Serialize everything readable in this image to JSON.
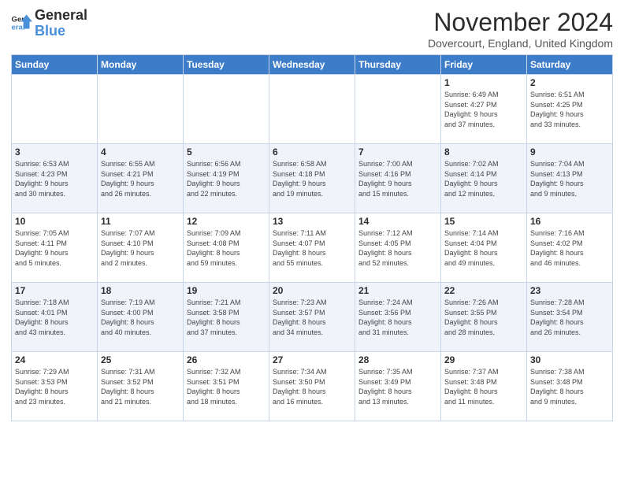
{
  "logo": {
    "line1": "General",
    "line2": "Blue"
  },
  "title": "November 2024",
  "subtitle": "Dovercourt, England, United Kingdom",
  "headers": [
    "Sunday",
    "Monday",
    "Tuesday",
    "Wednesday",
    "Thursday",
    "Friday",
    "Saturday"
  ],
  "weeks": [
    [
      {
        "day": "",
        "info": ""
      },
      {
        "day": "",
        "info": ""
      },
      {
        "day": "",
        "info": ""
      },
      {
        "day": "",
        "info": ""
      },
      {
        "day": "",
        "info": ""
      },
      {
        "day": "1",
        "info": "Sunrise: 6:49 AM\nSunset: 4:27 PM\nDaylight: 9 hours\nand 37 minutes."
      },
      {
        "day": "2",
        "info": "Sunrise: 6:51 AM\nSunset: 4:25 PM\nDaylight: 9 hours\nand 33 minutes."
      }
    ],
    [
      {
        "day": "3",
        "info": "Sunrise: 6:53 AM\nSunset: 4:23 PM\nDaylight: 9 hours\nand 30 minutes."
      },
      {
        "day": "4",
        "info": "Sunrise: 6:55 AM\nSunset: 4:21 PM\nDaylight: 9 hours\nand 26 minutes."
      },
      {
        "day": "5",
        "info": "Sunrise: 6:56 AM\nSunset: 4:19 PM\nDaylight: 9 hours\nand 22 minutes."
      },
      {
        "day": "6",
        "info": "Sunrise: 6:58 AM\nSunset: 4:18 PM\nDaylight: 9 hours\nand 19 minutes."
      },
      {
        "day": "7",
        "info": "Sunrise: 7:00 AM\nSunset: 4:16 PM\nDaylight: 9 hours\nand 15 minutes."
      },
      {
        "day": "8",
        "info": "Sunrise: 7:02 AM\nSunset: 4:14 PM\nDaylight: 9 hours\nand 12 minutes."
      },
      {
        "day": "9",
        "info": "Sunrise: 7:04 AM\nSunset: 4:13 PM\nDaylight: 9 hours\nand 9 minutes."
      }
    ],
    [
      {
        "day": "10",
        "info": "Sunrise: 7:05 AM\nSunset: 4:11 PM\nDaylight: 9 hours\nand 5 minutes."
      },
      {
        "day": "11",
        "info": "Sunrise: 7:07 AM\nSunset: 4:10 PM\nDaylight: 9 hours\nand 2 minutes."
      },
      {
        "day": "12",
        "info": "Sunrise: 7:09 AM\nSunset: 4:08 PM\nDaylight: 8 hours\nand 59 minutes."
      },
      {
        "day": "13",
        "info": "Sunrise: 7:11 AM\nSunset: 4:07 PM\nDaylight: 8 hours\nand 55 minutes."
      },
      {
        "day": "14",
        "info": "Sunrise: 7:12 AM\nSunset: 4:05 PM\nDaylight: 8 hours\nand 52 minutes."
      },
      {
        "day": "15",
        "info": "Sunrise: 7:14 AM\nSunset: 4:04 PM\nDaylight: 8 hours\nand 49 minutes."
      },
      {
        "day": "16",
        "info": "Sunrise: 7:16 AM\nSunset: 4:02 PM\nDaylight: 8 hours\nand 46 minutes."
      }
    ],
    [
      {
        "day": "17",
        "info": "Sunrise: 7:18 AM\nSunset: 4:01 PM\nDaylight: 8 hours\nand 43 minutes."
      },
      {
        "day": "18",
        "info": "Sunrise: 7:19 AM\nSunset: 4:00 PM\nDaylight: 8 hours\nand 40 minutes."
      },
      {
        "day": "19",
        "info": "Sunrise: 7:21 AM\nSunset: 3:58 PM\nDaylight: 8 hours\nand 37 minutes."
      },
      {
        "day": "20",
        "info": "Sunrise: 7:23 AM\nSunset: 3:57 PM\nDaylight: 8 hours\nand 34 minutes."
      },
      {
        "day": "21",
        "info": "Sunrise: 7:24 AM\nSunset: 3:56 PM\nDaylight: 8 hours\nand 31 minutes."
      },
      {
        "day": "22",
        "info": "Sunrise: 7:26 AM\nSunset: 3:55 PM\nDaylight: 8 hours\nand 28 minutes."
      },
      {
        "day": "23",
        "info": "Sunrise: 7:28 AM\nSunset: 3:54 PM\nDaylight: 8 hours\nand 26 minutes."
      }
    ],
    [
      {
        "day": "24",
        "info": "Sunrise: 7:29 AM\nSunset: 3:53 PM\nDaylight: 8 hours\nand 23 minutes."
      },
      {
        "day": "25",
        "info": "Sunrise: 7:31 AM\nSunset: 3:52 PM\nDaylight: 8 hours\nand 21 minutes."
      },
      {
        "day": "26",
        "info": "Sunrise: 7:32 AM\nSunset: 3:51 PM\nDaylight: 8 hours\nand 18 minutes."
      },
      {
        "day": "27",
        "info": "Sunrise: 7:34 AM\nSunset: 3:50 PM\nDaylight: 8 hours\nand 16 minutes."
      },
      {
        "day": "28",
        "info": "Sunrise: 7:35 AM\nSunset: 3:49 PM\nDaylight: 8 hours\nand 13 minutes."
      },
      {
        "day": "29",
        "info": "Sunrise: 7:37 AM\nSunset: 3:48 PM\nDaylight: 8 hours\nand 11 minutes."
      },
      {
        "day": "30",
        "info": "Sunrise: 7:38 AM\nSunset: 3:48 PM\nDaylight: 8 hours\nand 9 minutes."
      }
    ]
  ]
}
